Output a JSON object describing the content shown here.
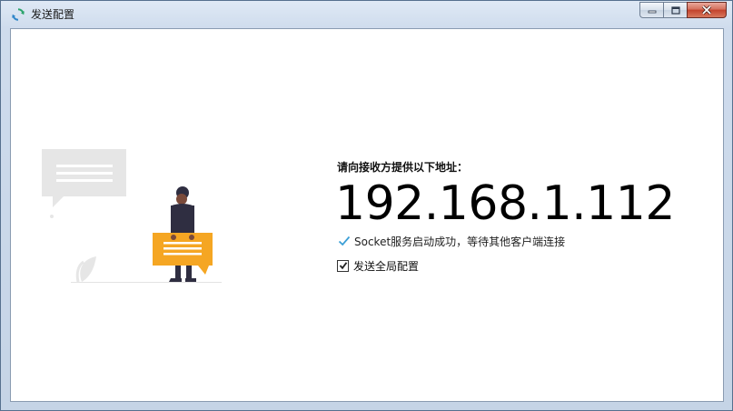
{
  "window": {
    "title": "发送配置",
    "icon": "refresh-sync-icon",
    "caption_buttons": [
      "minimize-icon",
      "maximize-icon",
      "close-icon"
    ]
  },
  "main": {
    "prompt": "请向接收方提供以下地址：",
    "ip_address": "192.168.1.112",
    "status": "Socket服务启动成功，等待其他客户端连接",
    "status_icon": "checkmark-icon",
    "status_color": "#3b9fd6",
    "checkbox_label": "发送全局配置",
    "checkbox_checked": true
  },
  "illustration": {
    "name": "person-with-chat-bubbles-illustration",
    "bubble_color": "#f5a623"
  }
}
